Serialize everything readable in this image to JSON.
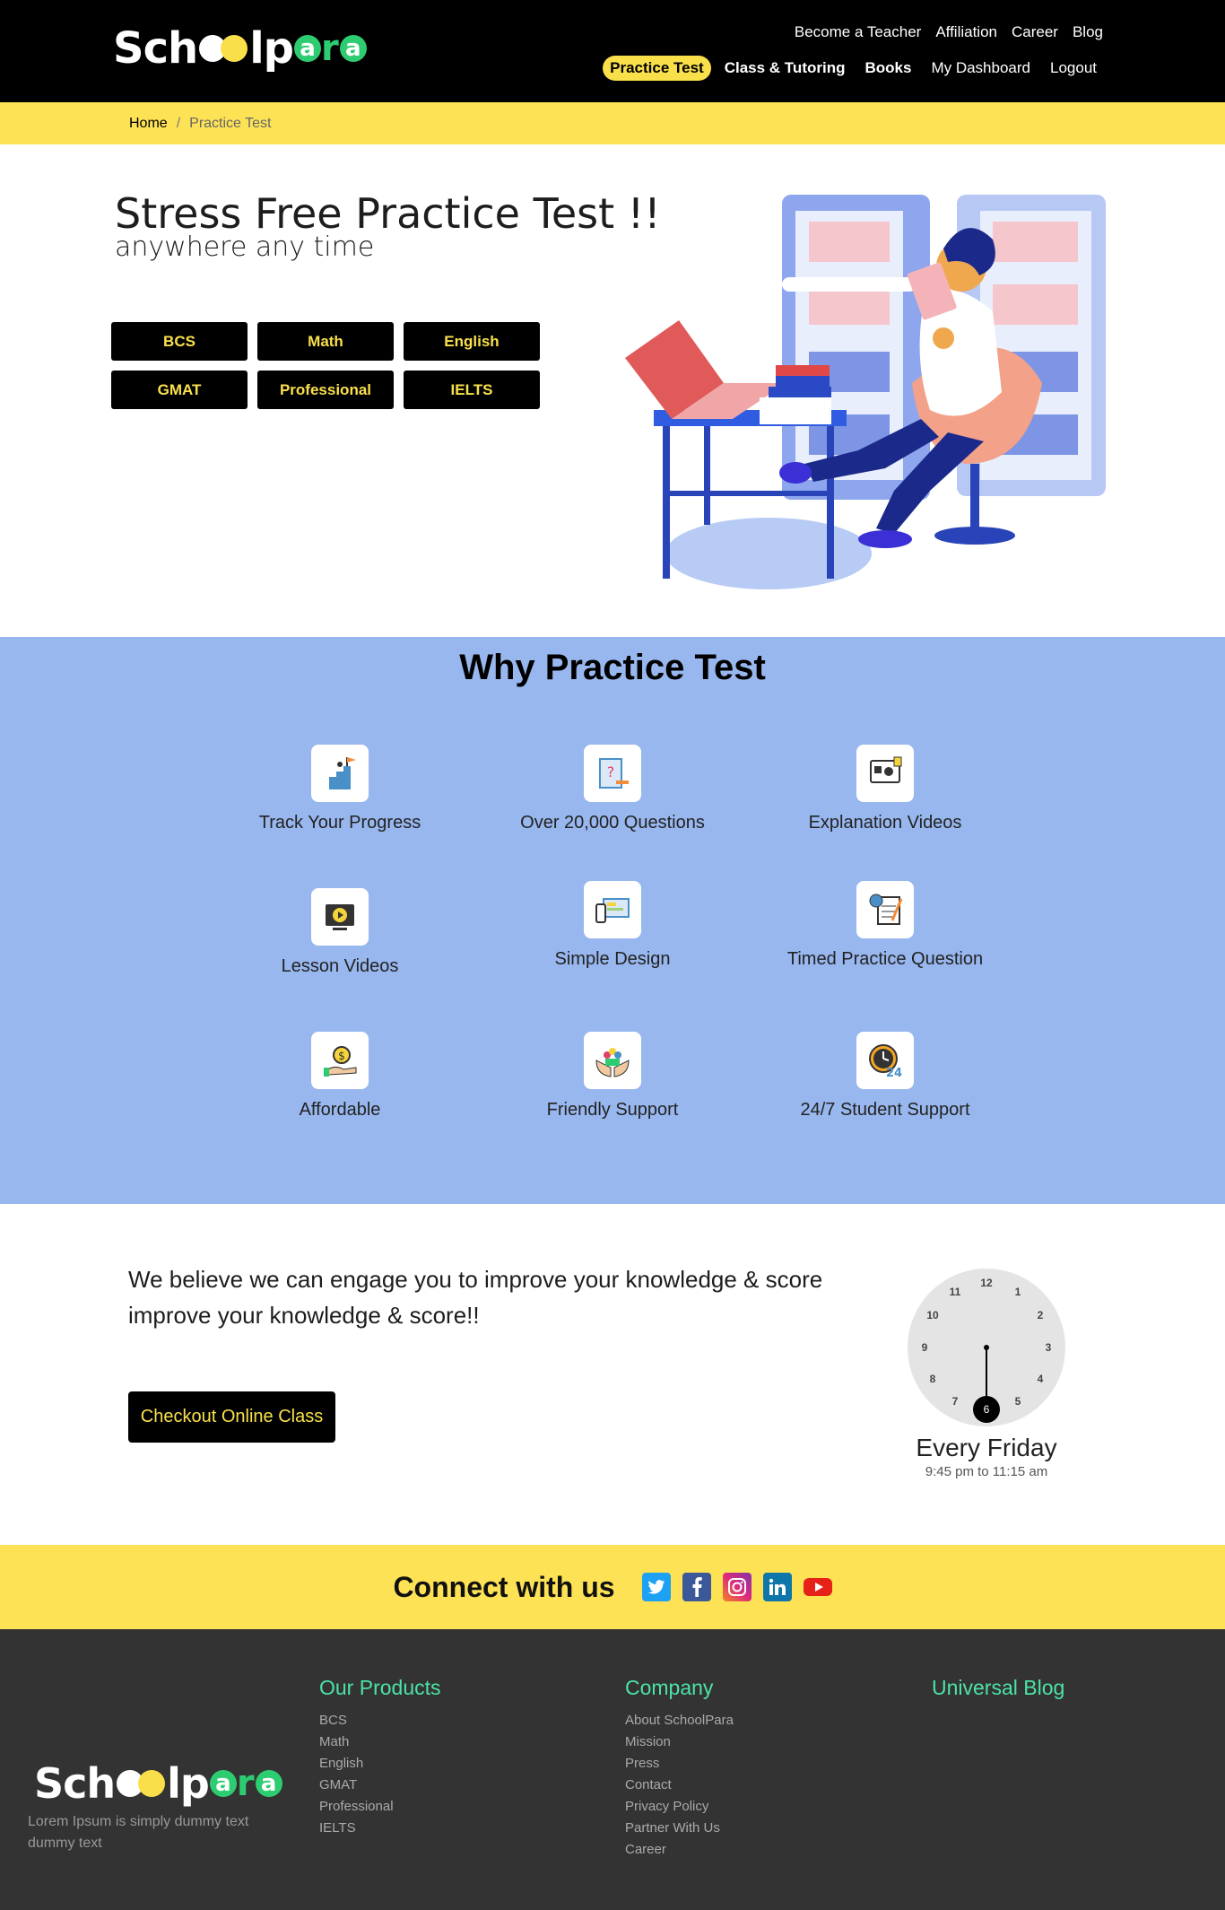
{
  "brand": {
    "logo_pre": "Sch",
    "logo_mid": "lp",
    "logo_a": "a",
    "logo_r": "r"
  },
  "header": {
    "top_links": [
      "Become a Teacher",
      "Affiliation",
      "Career",
      "Blog"
    ],
    "nav": {
      "practice_test": "Practice Test",
      "class_tutoring": "Class & Tutoring",
      "books": "Books",
      "dashboard": "My Dashboard",
      "logout": "Logout"
    }
  },
  "breadcrumb": {
    "home": "Home",
    "separator": "/",
    "current": "Practice Test"
  },
  "hero": {
    "title": "Stress Free Practice Test !!",
    "subtitle": "anywhere any time",
    "chips": [
      "BCS",
      "Math",
      "English",
      "GMAT",
      "Professional",
      "IELTS"
    ]
  },
  "why": {
    "title": "Why Practice Test",
    "features": [
      {
        "label": "Track Your Progress",
        "icon": "progress-flag-icon"
      },
      {
        "label": "Over 20,000 Questions",
        "icon": "question-doc-icon"
      },
      {
        "label": "Explanation Videos",
        "icon": "video-lesson-icon"
      },
      {
        "label": "Lesson Videos",
        "icon": "play-screen-icon"
      },
      {
        "label": "Simple Design",
        "icon": "devices-icon"
      },
      {
        "label": "Timed Practice Question",
        "icon": "timer-doc-icon"
      },
      {
        "label": "Affordable",
        "icon": "coin-hand-icon"
      },
      {
        "label": "Friendly Support",
        "icon": "support-hands-icon"
      },
      {
        "label": "24/7 Student Support",
        "icon": "clock-24-icon"
      }
    ]
  },
  "believe": {
    "text": "We believe we can engage you to improve your knowledge & score improve your knowledge & score!!",
    "cta": "Checkout Online Class",
    "schedule_day": "Every Friday",
    "schedule_time": "9:45 pm to 11:15 am"
  },
  "clock": {
    "numbers": [
      "12",
      "1",
      "2",
      "3",
      "4",
      "5",
      "6",
      "7",
      "8",
      "9",
      "10",
      "11"
    ]
  },
  "connect": {
    "title": "Connect with us",
    "icons": [
      "twitter-icon",
      "facebook-icon",
      "instagram-icon",
      "linkedin-icon",
      "youtube-icon"
    ]
  },
  "footer": {
    "description": "Lorem Ipsum is simply dummy text dummy text",
    "products": {
      "title": "Our Products",
      "items": [
        "BCS",
        "Math",
        "English",
        "GMAT",
        "Professional",
        "IELTS"
      ]
    },
    "company": {
      "title": "Company",
      "items": [
        "About SchoolPara",
        "Mission",
        "Press",
        "Contact",
        "Privacy Policy",
        "Partner With Us",
        "Career"
      ]
    },
    "blog": {
      "title": "Universal Blog"
    }
  },
  "colors": {
    "accent_yellow": "#fde256",
    "blue_section": "#98b7ee",
    "footer_bg": "#333333",
    "footer_heading": "#4be3a5"
  }
}
